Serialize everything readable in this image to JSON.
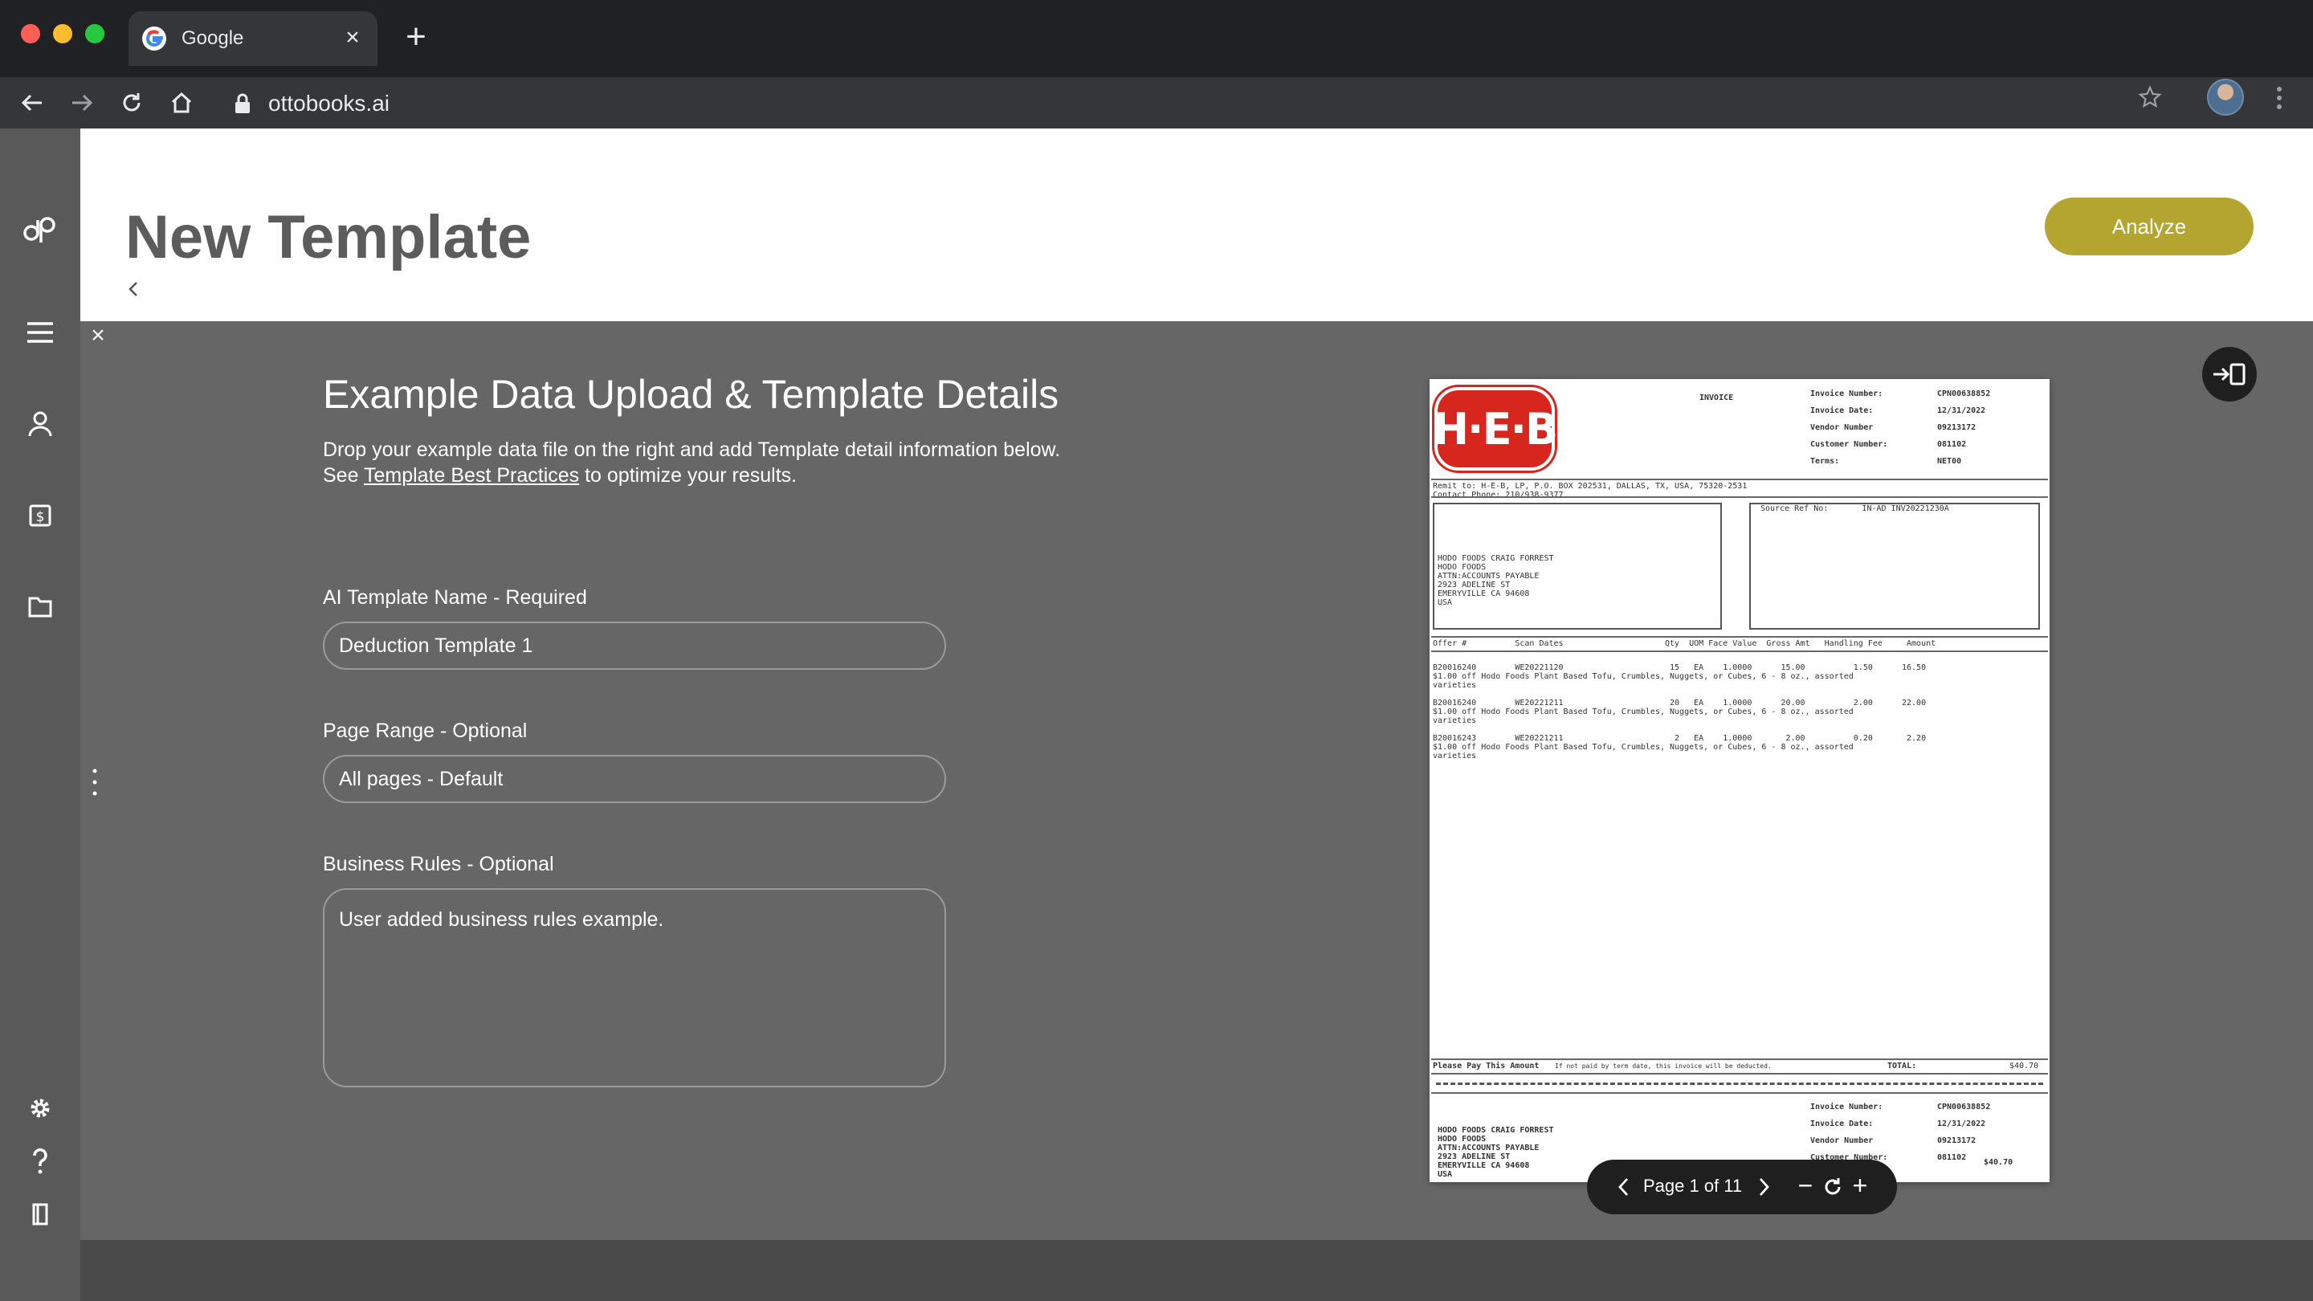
{
  "browser": {
    "tab_title": "Google",
    "url": "ottobooks.ai",
    "new_tab_label": "+",
    "tab_close_label": "×"
  },
  "header": {
    "title": "New Template",
    "analyze_label": "Analyze"
  },
  "panel": {
    "close_label": "×",
    "title": "Example Data Upload & Template Details",
    "desc_part1": "Drop your example data file on the right and add Template detail information below. See ",
    "desc_link": "Template Best Practices",
    "desc_part2": " to optimize your results."
  },
  "form": {
    "name_label": "AI Template Name - Required",
    "name_value": "Deduction Template 1",
    "range_label": "Page Range - Optional",
    "range_value": "All pages - Default",
    "rules_label": "Business Rules - Optional",
    "rules_value": "User added business rules example."
  },
  "pager": {
    "label": "Page 1 of 11",
    "zoom_out": "−",
    "zoom_in": "+"
  },
  "document": {
    "logo_text": "H·E·B",
    "invoice_label": "INVOICE",
    "meta_labels": "Invoice Number:\nInvoice Date:\nVendor Number\nCustomer Number:\nTerms:",
    "meta_values": "CPN00638852\n12/31/2022\n09213172\n081102\nNET00",
    "remit": "Remit to: H-E-B, LP, P.O. BOX 202531, DALLAS, TX, USA, 75320-2531\nContact Phone: 210/938-9377",
    "source_ref": "Source Ref No:       IN-AD INV20221230A",
    "bill_to": "HODO FOODS CRAIG FORREST\nHODO FOODS\nATTN:ACCOUNTS PAYABLE\n2923 ADELINE ST\nEMERYVILLE CA 94608\nUSA",
    "table_header": "Offer #          Scan Dates                     Qty  UOM Face Value  Gross Amt   Handling Fee     Amount",
    "rows": "B20016240        WE20221120                      15   EA    1.0000      15.00          1.50      16.50\n$1.00 off Hodo Foods Plant Based Tofu, Crumbles, Nuggets, or Cubes, 6 - 8 oz., assorted\nvarieties\n\nB20016240        WE20221211                      20   EA    1.0000      20.00          2.00      22.00\n$1.00 off Hodo Foods Plant Based Tofu, Crumbles, Nuggets, or Cubes, 6 - 8 oz., assorted\nvarieties\n\nB20016243        WE20221211                       2   EA    1.0000       2.00          0.20       2.20\n$1.00 off Hodo Foods Plant Based Tofu, Crumbles, Nuggets, or Cubes, 6 - 8 oz., assorted\nvarieties",
    "pay_line": "Please Pay This Amount",
    "pay_note": "If not paid by term date, this invoice will be deducted.",
    "total_label": "TOTAL:",
    "total_value": "$40.70",
    "stub_labels": "Invoice Number:\nInvoice Date:\nVendor Number\nCustomer Number:",
    "stub_values": "CPN00638852\n12/31/2022\n09213172\n081102",
    "stub_total": "$40.70",
    "stub_bill_to": "HODO FOODS CRAIG FORREST\nHODO FOODS\nATTN:ACCOUNTS PAYABLE\n2923 ADELINE ST\nEMERYVILLE CA 94608\nUSA"
  },
  "colors": {
    "accent": "#b4a530",
    "sidebar": "#595959",
    "content_bg": "#666666",
    "heb_red": "#d7261e"
  },
  "icons": [
    "back-arrow-icon",
    "forward-arrow-icon",
    "reload-icon",
    "home-icon",
    "lock-icon",
    "star-icon",
    "kebab-icon",
    "logo-icon",
    "menu-icon",
    "user-icon",
    "billing-icon",
    "folder-icon",
    "settings-icon",
    "help-icon",
    "book-icon",
    "drag-handle-icon",
    "dock-toggle-icon",
    "chevron-left-icon",
    "chevron-right-icon",
    "reset-zoom-icon"
  ]
}
